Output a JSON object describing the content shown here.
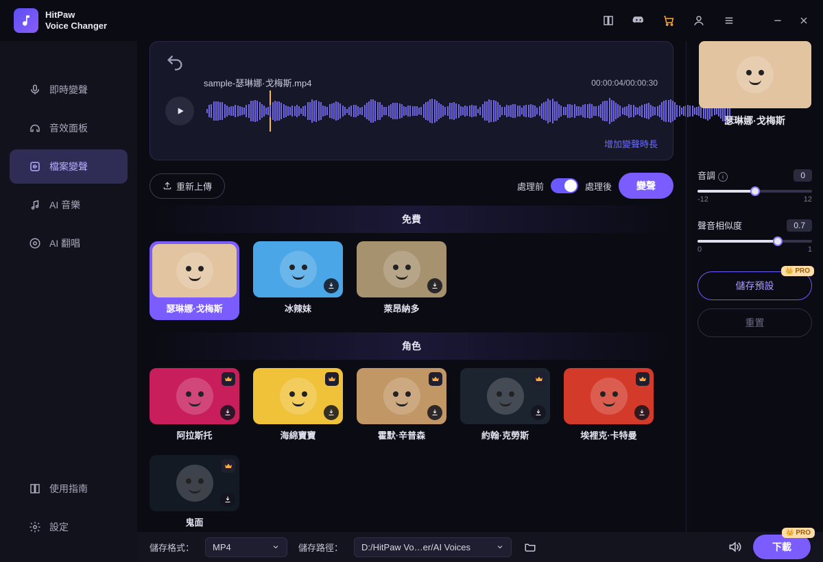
{
  "app": {
    "title_line1": "HitPaw",
    "title_line2": "Voice Changer"
  },
  "sidebar": {
    "items": [
      {
        "label": "即時變聲"
      },
      {
        "label": "音效面板"
      },
      {
        "label": "檔案變聲"
      },
      {
        "label": "AI 音樂"
      },
      {
        "label": "AI 翻唱"
      }
    ],
    "bottom": [
      {
        "label": "使用指南"
      },
      {
        "label": "設定"
      }
    ]
  },
  "player": {
    "filename": "sample-瑟琳娜·戈梅斯.mp4",
    "time": "00:00:04/00:00:30",
    "add_time": "增加變聲時長"
  },
  "controls": {
    "reupload": "重新上傳",
    "before": "處理前",
    "after": "處理後",
    "convert": "變聲"
  },
  "sections": {
    "free": "免費",
    "role": "角色"
  },
  "voices_free": [
    {
      "name": "瑟琳娜·戈梅斯",
      "bg": "#e3c4a0",
      "selected": true
    },
    {
      "name": "冰辣妹",
      "bg": "#4aa6e6",
      "dl": true
    },
    {
      "name": "萊昂納多",
      "bg": "#a7926f",
      "dl": true
    }
  ],
  "voices_role": [
    {
      "name": "阿拉斯托",
      "bg": "#c81f5c",
      "crown": true,
      "dl": true
    },
    {
      "name": "海綿寶寶",
      "bg": "#f0c23a",
      "crown": true,
      "dl": true
    },
    {
      "name": "霍默·辛普森",
      "bg": "#c19766",
      "crown": true,
      "dl": true
    },
    {
      "name": "約翰·克勞斯",
      "bg": "#1c2430",
      "crown": true,
      "dl": true
    },
    {
      "name": "埃裡克·卡特曼",
      "bg": "#d43a2a",
      "crown": true,
      "dl": true
    },
    {
      "name": "鬼面",
      "bg": "#141a24",
      "crown": true,
      "dl": true
    }
  ],
  "right": {
    "preview_name": "瑟琳娜·戈梅斯",
    "preview_bg": "#e3c4a0",
    "pitch_label": "音調",
    "pitch_value": "0",
    "pitch_min": "-12",
    "pitch_max": "12",
    "pitch_pct": 50,
    "sim_label": "聲音相似度",
    "sim_value": "0.7",
    "sim_min": "0",
    "sim_max": "1",
    "sim_pct": 70,
    "save_preset": "儲存預設",
    "reset": "重置",
    "pro": "PRO"
  },
  "bottom": {
    "format_label": "儲存格式：",
    "format_value": "MP4",
    "path_label": "儲存路徑：",
    "path_value": "D:/HitPaw Vo…er/AI Voices",
    "download": "下載",
    "pro": "PRO"
  }
}
